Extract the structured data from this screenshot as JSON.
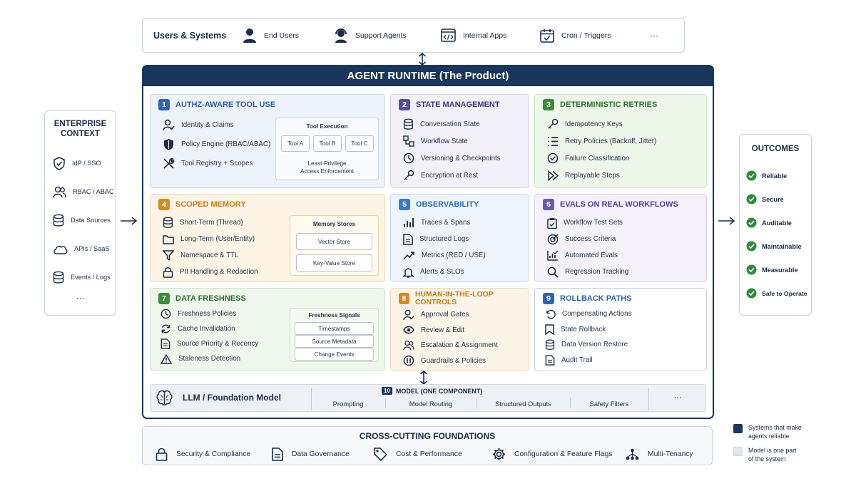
{
  "users": {
    "title": "Users & Systems",
    "items": [
      {
        "label": "End Users",
        "icon": "person-icon"
      },
      {
        "label": "Support Agents",
        "icon": "headset-icon"
      },
      {
        "label": "Internal Apps",
        "icon": "code-window-icon"
      },
      {
        "label": "Cron / Triggers",
        "icon": "calendar-icon"
      }
    ],
    "more": "···"
  },
  "runtime": {
    "title": "AGENT RUNTIME (The Product)",
    "cards": [
      {
        "num": "1",
        "title": "AUTHZ-AWARE TOOL USE",
        "items": [
          "Identity & Claims",
          "Policy Engine (RBAC/ABAC)",
          "Tool Registry + Scopes"
        ],
        "panel": {
          "title": "Tool Execution",
          "chips": [
            "Tool A",
            "Tool B",
            "Tool C"
          ],
          "note_line1": "Least-Privilege",
          "note_line2": "Access Enforcement"
        }
      },
      {
        "num": "2",
        "title": "STATE MANAGEMENT",
        "items": [
          "Conversation State",
          "Workflow State",
          "Versioning & Checkpoints",
          "Encryption at Rest"
        ]
      },
      {
        "num": "3",
        "title": "DETERMINISTIC RETRIES",
        "items": [
          "Idempotency Keys",
          "Retry Policies (Backoff, Jitter)",
          "Failure Classification",
          "Replayable Steps"
        ]
      },
      {
        "num": "4",
        "title": "SCOPED MEMORY",
        "items": [
          "Short-Term (Thread)",
          "Long-Term (User/Entity)",
          "Namespace & TTL",
          "PII Handling & Redaction"
        ],
        "panel": {
          "title": "Memory Stores",
          "chips": [
            "Vector Store",
            "Key-Value Store"
          ]
        }
      },
      {
        "num": "5",
        "title": "OBSERVABILITY",
        "items": [
          "Traces & Spans",
          "Structured Logs",
          "Metrics (RED / USE)",
          "Alerts & SLOs"
        ]
      },
      {
        "num": "6",
        "title": "EVALS ON REAL WORKFLOWS",
        "items": [
          "Workflow Test Sets",
          "Success Criteria",
          "Automated Evals",
          "Regression Tracking"
        ]
      },
      {
        "num": "7",
        "title": "DATA FRESHNESS",
        "items": [
          "Freshness Policies",
          "Cache Invalidation",
          "Source Priority & Recency",
          "Staleness Detection"
        ],
        "panel": {
          "title": "Freshness Signals",
          "chips": [
            "Timestamps",
            "Source Metadata",
            "Change Events"
          ]
        }
      },
      {
        "num": "8",
        "title": "HUMAN-IN-THE-LOOP CONTROLS",
        "items": [
          "Approval Gates",
          "Review & Edit",
          "Escalation & Assignment",
          "Guardrails & Policies"
        ]
      },
      {
        "num": "9",
        "title": "ROLLBACK PATHS",
        "items": [
          "Compensating Actions",
          "State Rollback",
          "Data Version Restore",
          "Audit Trail"
        ]
      }
    ],
    "model": {
      "llm_label": "LLM / Foundation Model",
      "num": "10",
      "title": "MODEL (ONE COMPONENT)",
      "items": [
        "Prompting",
        "Model Routing",
        "Structured Outputs",
        "Safety Filters"
      ],
      "more": "···"
    }
  },
  "enterprise": {
    "title_line1": "ENTERPRISE",
    "title_line2": "CONTEXT",
    "items": [
      "IdP / SSO",
      "RBAC / ABAC",
      "Data Sources",
      "APIs / SaaS",
      "Events / Logs"
    ],
    "more": "···"
  },
  "outcomes": {
    "title": "OUTCOMES",
    "items": [
      "Reliable",
      "Secure",
      "Auditable",
      "Maintainable",
      "Measurable",
      "Safe to Operate"
    ]
  },
  "foundations": {
    "title": "CROSS-CUTTING FOUNDATIONS",
    "items": [
      "Security & Compliance",
      "Data Governance",
      "Cost & Performance",
      "Configuration & Feature Flags",
      "Multi-Tenancy"
    ]
  },
  "legend": {
    "items": [
      {
        "line1": "Systems that make",
        "line2": "agents reliable",
        "color": "#1b365d"
      },
      {
        "line1": "Model is one part",
        "line2": "of the system",
        "color": "#e3e6ec"
      }
    ]
  },
  "colors": {
    "navy": "#1b365d",
    "green_check": "#2e8b3a"
  }
}
